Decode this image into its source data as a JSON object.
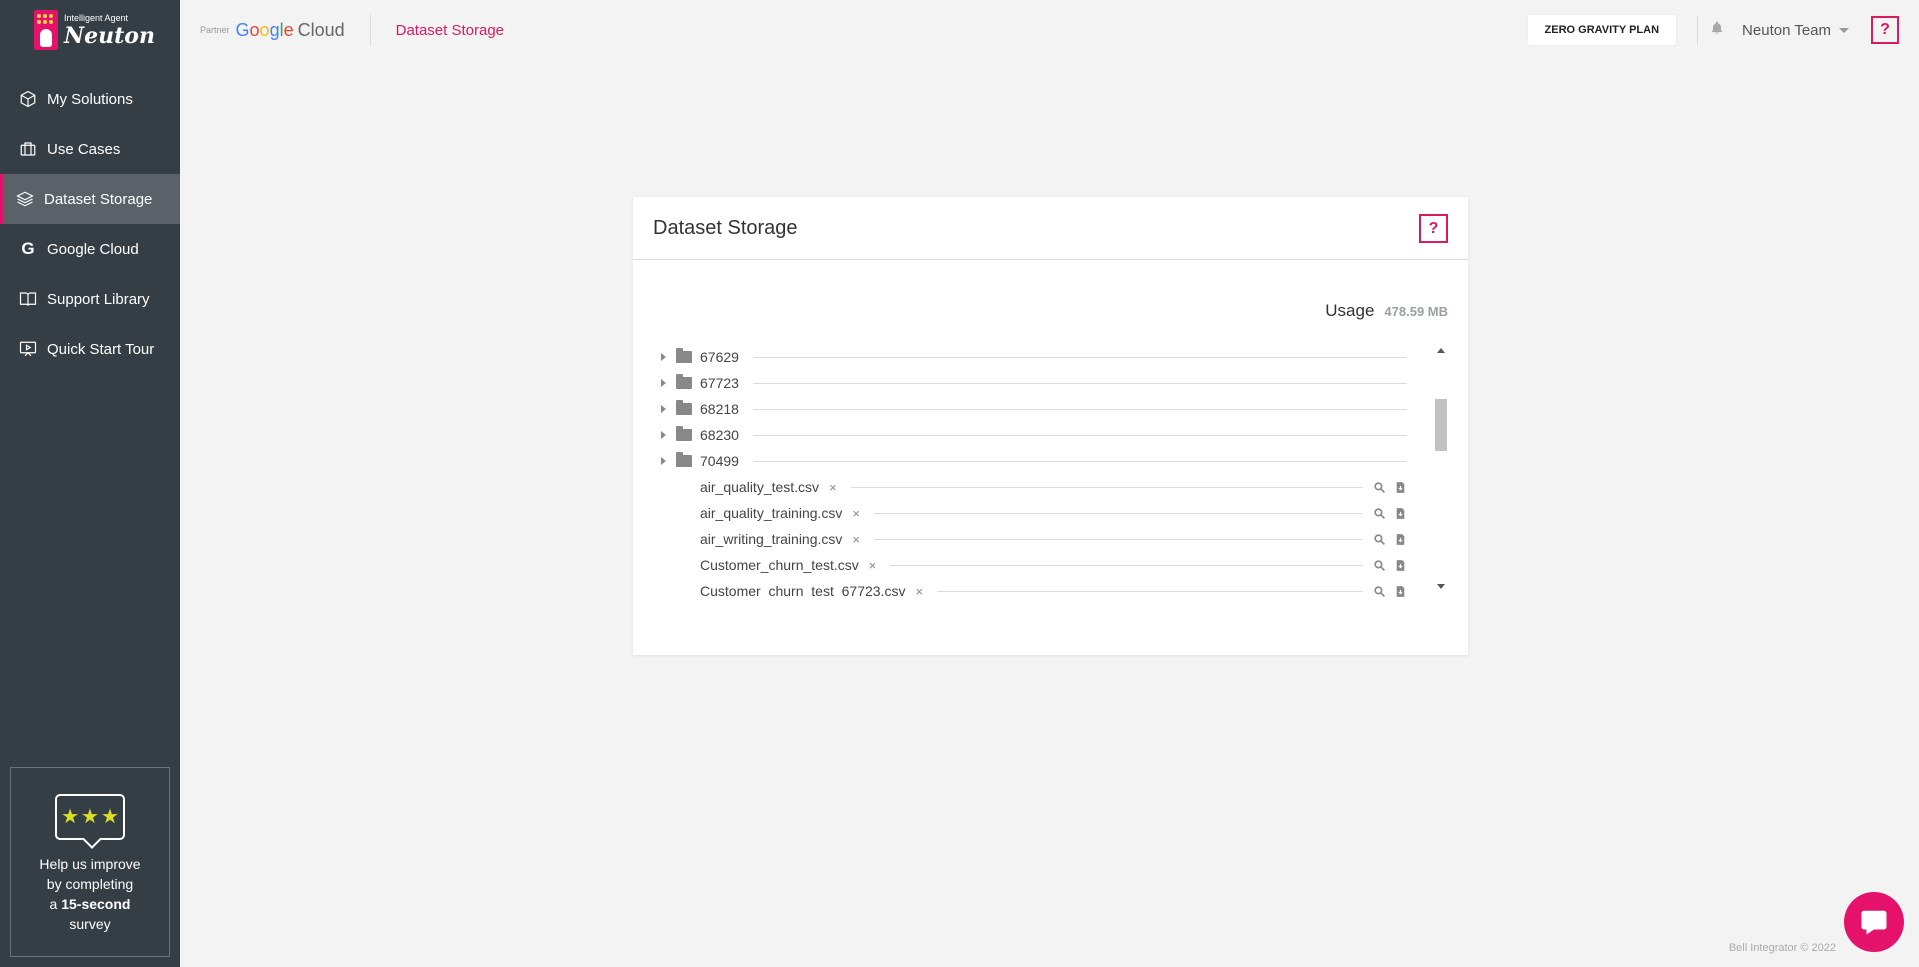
{
  "app": {
    "logo_small": "Intelligent Agent",
    "logo_big": "Neuton"
  },
  "sidebar": {
    "items": [
      {
        "label": "My Solutions",
        "icon": "cube-icon"
      },
      {
        "label": "Use Cases",
        "icon": "briefcase-icon"
      },
      {
        "label": "Dataset Storage",
        "icon": "layers-icon",
        "active": true
      },
      {
        "label": "Google Cloud",
        "icon": "google-g-icon"
      },
      {
        "label": "Support Library",
        "icon": "book-icon"
      },
      {
        "label": "Quick Start Tour",
        "icon": "presentation-icon"
      }
    ],
    "survey": {
      "line1": "Help us improve",
      "line2": "by completing",
      "line3_pre": "a ",
      "line3_bold": "15-second",
      "line4": "survey"
    }
  },
  "topbar": {
    "partner": "Partner",
    "google": "Google",
    "cloud": "Cloud",
    "breadcrumb": "Dataset Storage",
    "plan_button": "ZERO GRAVITY PLAN",
    "user": "Neuton Team",
    "help": "?"
  },
  "card": {
    "title": "Dataset Storage",
    "help": "?",
    "usage_label": "Usage",
    "usage_value": "478.59 MB",
    "folders": [
      "67629",
      "67723",
      "68218",
      "68230",
      "70499"
    ],
    "files": [
      "air_quality_test.csv",
      "air_quality_training.csv",
      "air_writing_training.csv",
      "Customer_churn_test.csv",
      "Customer_churn_test_67723.csv"
    ],
    "remove_symbol": "×"
  },
  "footer": {
    "copyright": "Bell Integrator © 2022"
  },
  "colors": {
    "brand": "#e5126c",
    "sidebar_bg": "#363e45",
    "sidebar_active": "#5a6168"
  }
}
